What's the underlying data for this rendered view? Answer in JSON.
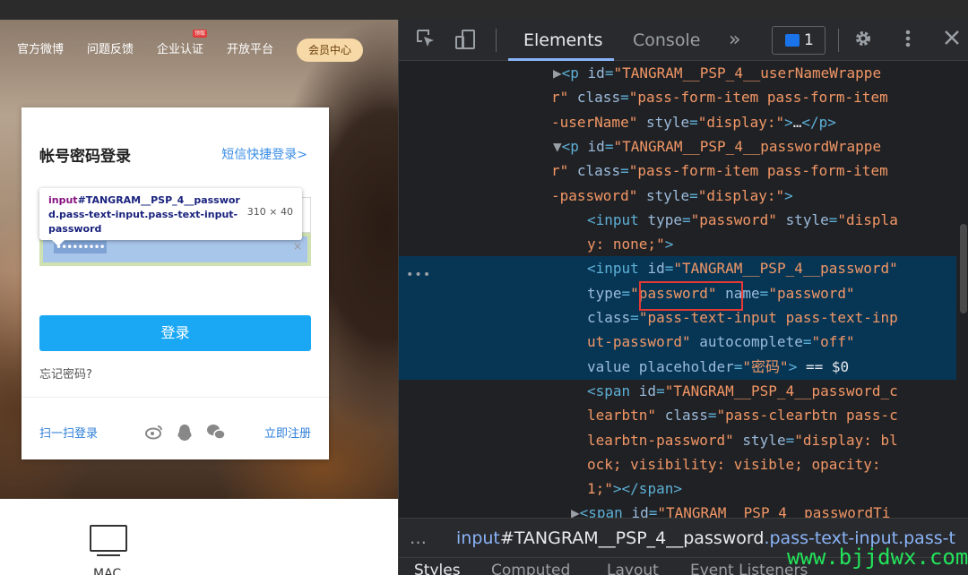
{
  "site": {
    "nav": [
      "官方微博",
      "问题反馈",
      "企业认证",
      "开放平台"
    ],
    "nav_badge": "领取",
    "member_button": "会员中心"
  },
  "login": {
    "title": "帐号密码登录",
    "sms_link": "短信快捷登录>",
    "password_mask": "•••••••••",
    "clear_symbol": "×",
    "login_button": "登录",
    "forgot": "忘记密码?",
    "qr_login": "扫一扫登录",
    "register": "立即注册",
    "social_icons": [
      "weibo-icon",
      "qq-icon",
      "wechat-icon"
    ]
  },
  "inspect_tooltip": {
    "tag": "input",
    "selector": "#TANGRAM__PSP_4__password.pass-text-input.pass-text-input-password",
    "size": "310 × 40"
  },
  "mac": {
    "label": "MAC"
  },
  "devtools": {
    "tabs": [
      "Elements",
      "Console"
    ],
    "more_tabs": "»",
    "issues_count": "1",
    "selected_marker": "== $0",
    "breadcrumb_dots": "…",
    "breadcrumb": {
      "tag": "input",
      "id": "#TANGRAM__PSP_4__password",
      "classes": ".pass-text-input.pass-t"
    },
    "bottom_tabs": [
      "Styles",
      "Computed",
      "Layout",
      "Event Listeners"
    ],
    "highlighted_value": "\"password\""
  },
  "watermark": "www.bjjdwx.com",
  "colors": {
    "accent": "#1aa8f5",
    "selection": "#073655",
    "highlight_box": "#e53935"
  }
}
